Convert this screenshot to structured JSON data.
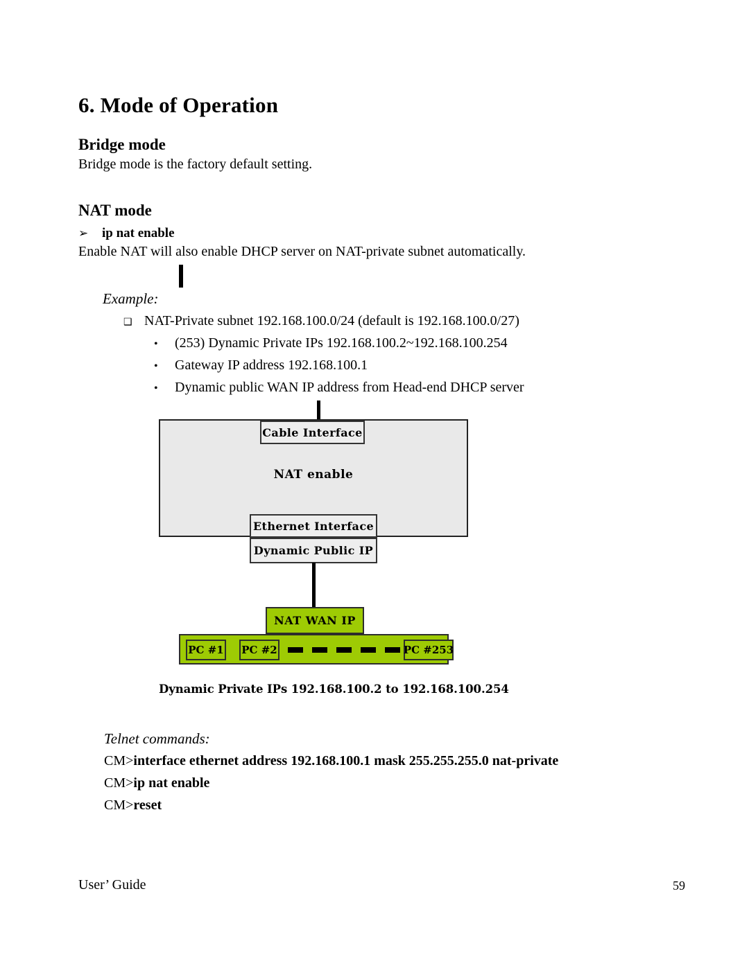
{
  "document": {
    "chapter_heading": "6. Mode of Operation",
    "sections": {
      "bridge": {
        "heading": "Bridge mode",
        "body": "Bridge mode is the factory default setting."
      },
      "nat": {
        "heading": "NAT mode",
        "command_item": "ip nat enable",
        "arrow_bullet": "➢",
        "body": "Enable NAT will also enable DHCP server on NAT-private subnet automatically."
      }
    },
    "example": {
      "label": "Example:",
      "square_bullet": "❑",
      "round_bullet": "•",
      "primary_item": "NAT-Private subnet 192.168.100.0/24 (default is 192.168.100.0/27)",
      "sub_items": [
        "(253) Dynamic Private IPs 192.168.100.2~192.168.100.254",
        "Gateway IP address 192.168.100.1",
        "Dynamic public WAN IP address from Head-end DHCP server"
      ]
    },
    "diagram": {
      "device_label": "NAT enable",
      "cable_interface": "Cable Interface",
      "ethernet_interface": "Ethernet  Interface",
      "dynamic_public_ip": "Dynamic Public  IP",
      "nat_wan_ip": "NAT WAN IP",
      "pcs": [
        "PC #1",
        "PC #2",
        "PC #253"
      ],
      "dash_count": 5,
      "caption": "Dynamic Private IPs 192.168.100.2 to 192.168.100.254",
      "colors": {
        "device_fill": "#e9e9e9",
        "lan_fill": "#9ECB04",
        "stroke": "#2d2d2d"
      }
    },
    "telnet": {
      "label": "Telnet commands:",
      "prompt": "CM>",
      "commands": [
        "interface ethernet address 192.168.100.1 mask 255.255.255.0 nat-private",
        "ip nat enable",
        "reset"
      ]
    },
    "footer": {
      "left": "User’ Guide",
      "page_number": "59"
    }
  }
}
